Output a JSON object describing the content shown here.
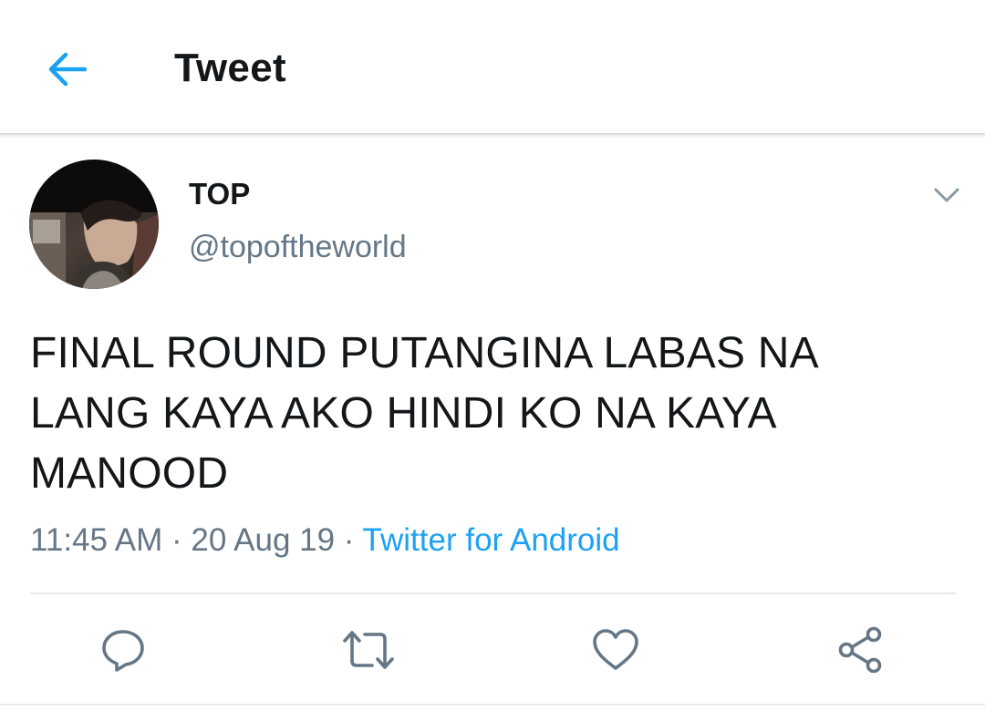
{
  "header": {
    "title": "Tweet",
    "back_icon": "arrow-left-icon"
  },
  "tweet": {
    "author": {
      "name": "TOP",
      "handle": "@topoftheworld"
    },
    "text": "FINAL ROUND PUTANGINA LABAS NA LANG KAYA AKO HINDI KO NA KAYA MANOOD",
    "time": "11:45 AM",
    "date": "20 Aug 19",
    "separator": "·",
    "source": "Twitter for Android",
    "menu_icon": "chevron-down-icon"
  },
  "actions": [
    {
      "icon": "reply-icon"
    },
    {
      "icon": "retweet-icon"
    },
    {
      "icon": "like-icon"
    },
    {
      "icon": "share-icon"
    }
  ],
  "colors": {
    "accent": "#1da1f2",
    "text": "#14171a",
    "secondary": "#657786",
    "icon": "#657786"
  }
}
